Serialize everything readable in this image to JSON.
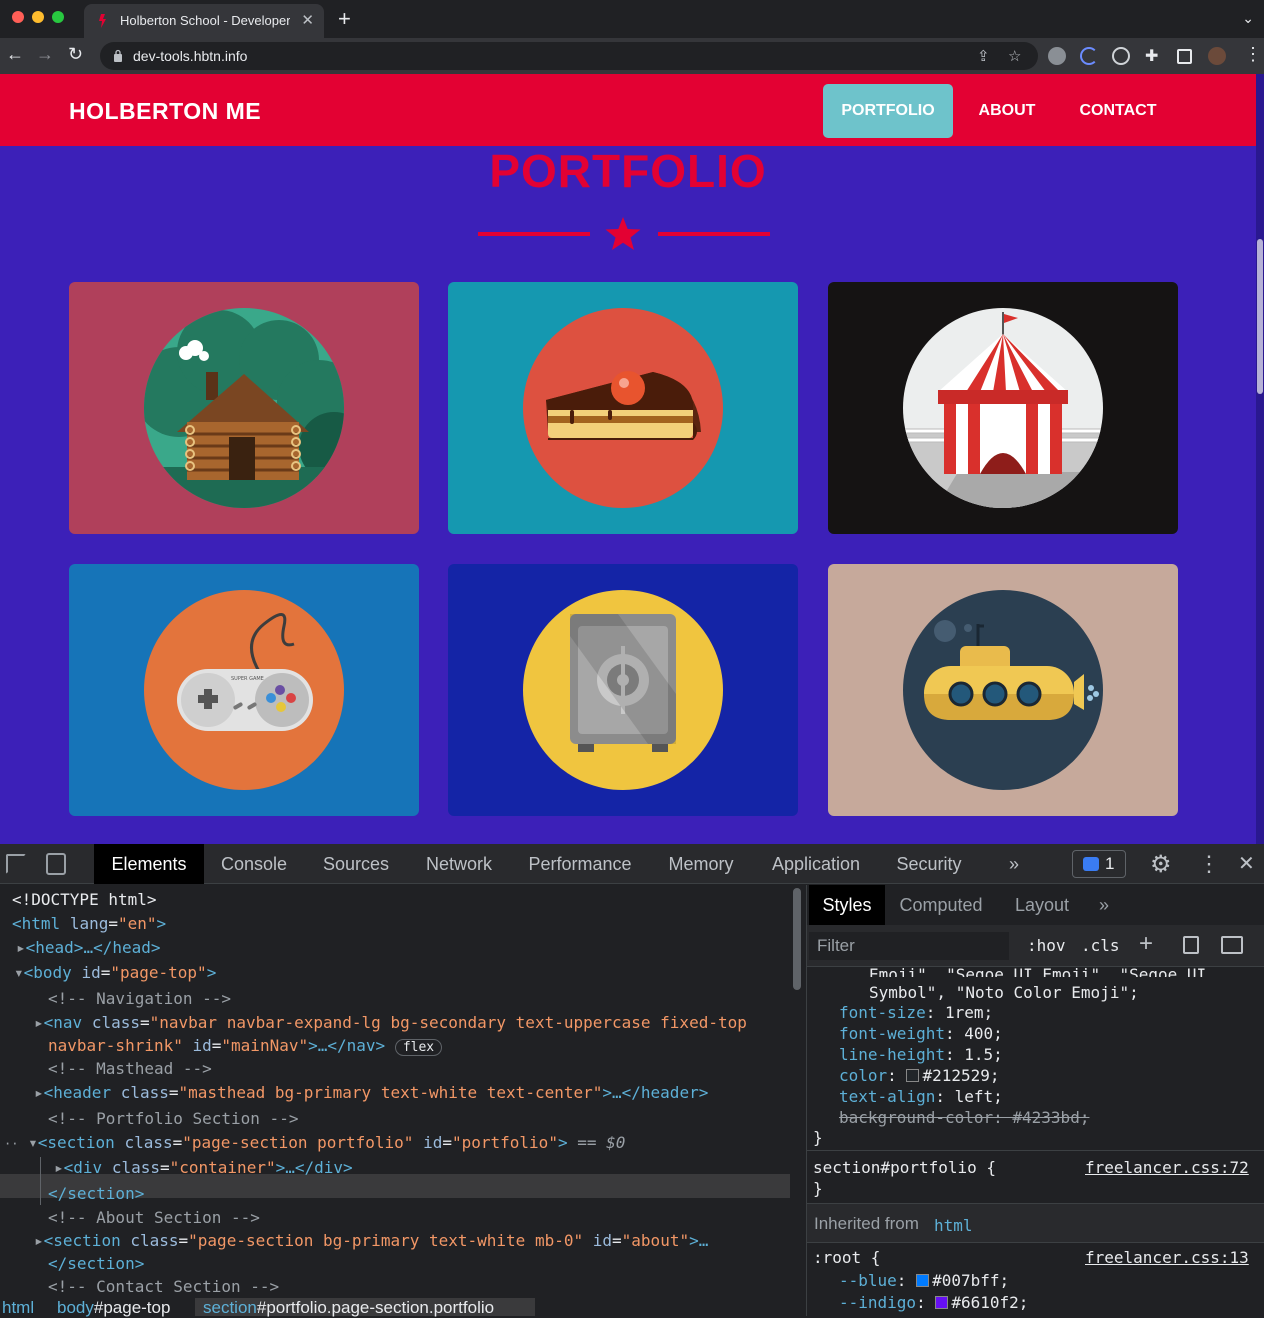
{
  "browser": {
    "tab_title": "Holberton School - Developer Tools",
    "url": "dev-tools.hbtn.info"
  },
  "site": {
    "brand": "HOLBERTON ME",
    "nav": [
      "PORTFOLIO",
      "ABOUT",
      "CONTACT"
    ],
    "active_nav": "PORTFOLIO",
    "heading": "PORTFOLIO",
    "colors": {
      "nav_bg": "#e30133",
      "page_bg": "#3c20b8",
      "active_nav_bg": "#6ec3cb",
      "accent": "#e30133"
    },
    "portfolio_items": [
      {
        "icon": "cabin-icon",
        "bg": "#b0405b"
      },
      {
        "icon": "cake-icon",
        "bg": "#1598b0"
      },
      {
        "icon": "circus-tent-icon",
        "bg": "#151313"
      },
      {
        "icon": "game-controller-icon",
        "bg": "#1674b8"
      },
      {
        "icon": "safe-icon",
        "bg": "#1424a6"
      },
      {
        "icon": "submarine-icon",
        "bg": "#c6a99b"
      }
    ],
    "controller_label": "SUPER GAME"
  },
  "devtools": {
    "tabs": [
      "Elements",
      "Console",
      "Sources",
      "Network",
      "Performance",
      "Memory",
      "Application",
      "Security"
    ],
    "active_tab": "Elements",
    "more_tabs": "»",
    "issues_count": "1",
    "elements": {
      "doctype": "<!DOCTYPE html>",
      "html_tag": "<html",
      "html_lang_attr": "lang",
      "html_lang_val": "\"en\"",
      "head": "<head>…</head>",
      "body_open": "<body",
      "body_id_attr": "id",
      "body_id_val": "\"page-top\"",
      "comment_nav": "<!-- Navigation -->",
      "nav_open": "<nav",
      "nav_class_attr": "class",
      "nav_class_val_1": "\"navbar navbar-expand-lg bg-secondary text-uppercase fixed-top",
      "nav_class_val_2": "navbar-shrink\"",
      "nav_id_attr": "id",
      "nav_id_val": "\"mainNav\"",
      "nav_close": ">…</nav>",
      "flex_badge": "flex",
      "comment_masthead": "<!-- Masthead -->",
      "header_open": "<header",
      "header_class_attr": "class",
      "header_class_val": "\"masthead bg-primary text-white text-center\"",
      "header_close": ">…</header>",
      "comment_portfolio": "<!-- Portfolio Section -->",
      "section_open": "<section",
      "section_class_attr": "class",
      "section_class_val": "\"page-section portfolio\"",
      "section_id_attr": "id",
      "section_id_val": "\"portfolio\"",
      "section_gt": ">",
      "dollar_zero": "== $0",
      "div_open": "<div",
      "div_class_attr": "class",
      "div_class_val": "\"container\"",
      "div_close": ">…</div>",
      "section_close": "</section>",
      "comment_about": "<!-- About Section -->",
      "section2_class_val": "\"page-section bg-primary text-white mb-0\"",
      "section2_id_val": "\"about\"",
      "section2_close": ">…",
      "section2_end": "</section>",
      "comment_contact": "<!-- Contact Section -->"
    },
    "breadcrumbs": {
      "html": "html",
      "body_tag": "body",
      "body_id": "#page-top",
      "section_tag": "section",
      "section_rest": "#portfolio.page-section.portfolio"
    },
    "styles": {
      "tabs": [
        "Styles",
        "Computed",
        "Layout"
      ],
      "active": "Styles",
      "more": "»",
      "filter_placeholder": "Filter",
      "hov": ":hov",
      "cls": ".cls",
      "font_line_1": "Emoji\", \"Segoe UI Emoji\", \"Segoe UI",
      "font_line_2": "Symbol\", \"Noto Color Emoji\";",
      "rules": [
        {
          "prop": "font-size",
          "val": "1rem;"
        },
        {
          "prop": "font-weight",
          "val": "400;"
        },
        {
          "prop": "line-height",
          "val": "1.5;"
        },
        {
          "prop": "color",
          "val": "#212529;",
          "swatch": "#212529"
        },
        {
          "prop": "text-align",
          "val": "left;"
        }
      ],
      "struck": "background-color: #4233bd;",
      "close_brace": "}",
      "selector": "section#portfolio {",
      "selector_source": "freelancer.css:72",
      "inherited_label": "Inherited from",
      "inherited_tag": "html",
      "root_selector": ":root {",
      "root_source": "freelancer.css:13",
      "vars": [
        {
          "prop": "--blue",
          "val": "#007bff;",
          "swatch": "#007bff"
        },
        {
          "prop": "--indigo",
          "val": "#6610f2;",
          "swatch": "#6610f2"
        }
      ]
    }
  }
}
